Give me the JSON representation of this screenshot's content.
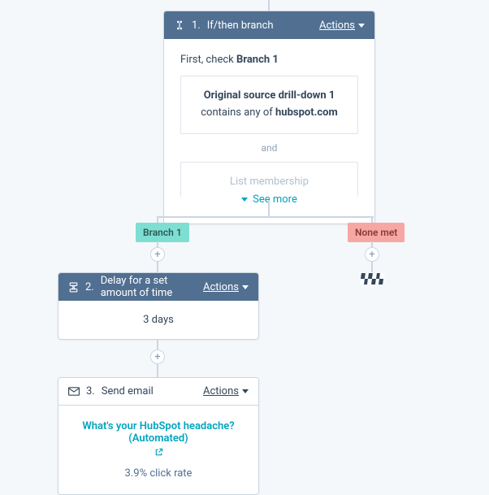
{
  "step1": {
    "number": "1.",
    "title": "If/then branch",
    "actions": "Actions",
    "first_check_prefix": "First, check ",
    "first_check_branch": "Branch 1",
    "cond1_prefix": "Original source drill-down 1",
    "cond1_mid": " contains any of ",
    "cond1_value": "hubspot.com",
    "and": "and",
    "cond2": "List membership",
    "see_more": "See more"
  },
  "branches": {
    "branch1_label": "Branch 1",
    "none_met_label": "None met"
  },
  "step2": {
    "number": "2.",
    "title": "Delay for a set amount of time",
    "actions": "Actions",
    "value": "3 days"
  },
  "step3": {
    "number": "3.",
    "title": "Send email",
    "actions": "Actions",
    "email_name": "What's your HubSpot headache? (Automated)",
    "click_rate": "3.9% click rate"
  }
}
